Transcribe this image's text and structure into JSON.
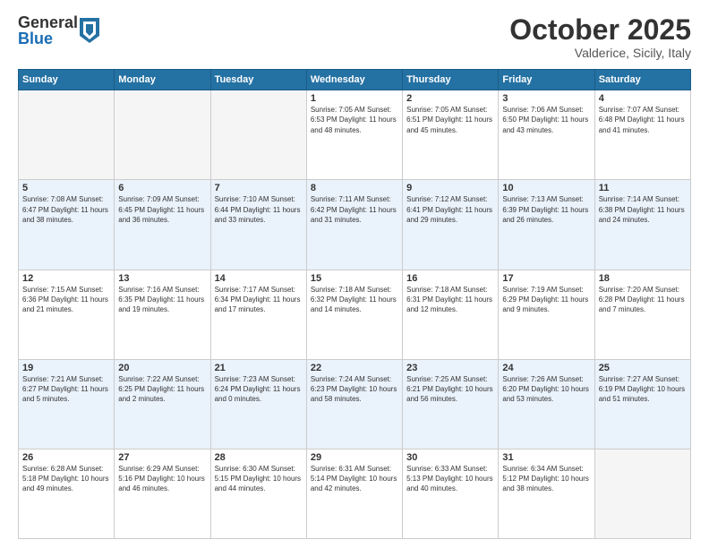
{
  "header": {
    "logo": {
      "general": "General",
      "blue": "Blue"
    },
    "title": "October 2025",
    "location": "Valderice, Sicily, Italy"
  },
  "days_of_week": [
    "Sunday",
    "Monday",
    "Tuesday",
    "Wednesday",
    "Thursday",
    "Friday",
    "Saturday"
  ],
  "weeks": [
    [
      {
        "day": "",
        "info": ""
      },
      {
        "day": "",
        "info": ""
      },
      {
        "day": "",
        "info": ""
      },
      {
        "day": "1",
        "info": "Sunrise: 7:05 AM\nSunset: 6:53 PM\nDaylight: 11 hours\nand 48 minutes."
      },
      {
        "day": "2",
        "info": "Sunrise: 7:05 AM\nSunset: 6:51 PM\nDaylight: 11 hours\nand 45 minutes."
      },
      {
        "day": "3",
        "info": "Sunrise: 7:06 AM\nSunset: 6:50 PM\nDaylight: 11 hours\nand 43 minutes."
      },
      {
        "day": "4",
        "info": "Sunrise: 7:07 AM\nSunset: 6:48 PM\nDaylight: 11 hours\nand 41 minutes."
      }
    ],
    [
      {
        "day": "5",
        "info": "Sunrise: 7:08 AM\nSunset: 6:47 PM\nDaylight: 11 hours\nand 38 minutes."
      },
      {
        "day": "6",
        "info": "Sunrise: 7:09 AM\nSunset: 6:45 PM\nDaylight: 11 hours\nand 36 minutes."
      },
      {
        "day": "7",
        "info": "Sunrise: 7:10 AM\nSunset: 6:44 PM\nDaylight: 11 hours\nand 33 minutes."
      },
      {
        "day": "8",
        "info": "Sunrise: 7:11 AM\nSunset: 6:42 PM\nDaylight: 11 hours\nand 31 minutes."
      },
      {
        "day": "9",
        "info": "Sunrise: 7:12 AM\nSunset: 6:41 PM\nDaylight: 11 hours\nand 29 minutes."
      },
      {
        "day": "10",
        "info": "Sunrise: 7:13 AM\nSunset: 6:39 PM\nDaylight: 11 hours\nand 26 minutes."
      },
      {
        "day": "11",
        "info": "Sunrise: 7:14 AM\nSunset: 6:38 PM\nDaylight: 11 hours\nand 24 minutes."
      }
    ],
    [
      {
        "day": "12",
        "info": "Sunrise: 7:15 AM\nSunset: 6:36 PM\nDaylight: 11 hours\nand 21 minutes."
      },
      {
        "day": "13",
        "info": "Sunrise: 7:16 AM\nSunset: 6:35 PM\nDaylight: 11 hours\nand 19 minutes."
      },
      {
        "day": "14",
        "info": "Sunrise: 7:17 AM\nSunset: 6:34 PM\nDaylight: 11 hours\nand 17 minutes."
      },
      {
        "day": "15",
        "info": "Sunrise: 7:18 AM\nSunset: 6:32 PM\nDaylight: 11 hours\nand 14 minutes."
      },
      {
        "day": "16",
        "info": "Sunrise: 7:18 AM\nSunset: 6:31 PM\nDaylight: 11 hours\nand 12 minutes."
      },
      {
        "day": "17",
        "info": "Sunrise: 7:19 AM\nSunset: 6:29 PM\nDaylight: 11 hours\nand 9 minutes."
      },
      {
        "day": "18",
        "info": "Sunrise: 7:20 AM\nSunset: 6:28 PM\nDaylight: 11 hours\nand 7 minutes."
      }
    ],
    [
      {
        "day": "19",
        "info": "Sunrise: 7:21 AM\nSunset: 6:27 PM\nDaylight: 11 hours\nand 5 minutes."
      },
      {
        "day": "20",
        "info": "Sunrise: 7:22 AM\nSunset: 6:25 PM\nDaylight: 11 hours\nand 2 minutes."
      },
      {
        "day": "21",
        "info": "Sunrise: 7:23 AM\nSunset: 6:24 PM\nDaylight: 11 hours\nand 0 minutes."
      },
      {
        "day": "22",
        "info": "Sunrise: 7:24 AM\nSunset: 6:23 PM\nDaylight: 10 hours\nand 58 minutes."
      },
      {
        "day": "23",
        "info": "Sunrise: 7:25 AM\nSunset: 6:21 PM\nDaylight: 10 hours\nand 56 minutes."
      },
      {
        "day": "24",
        "info": "Sunrise: 7:26 AM\nSunset: 6:20 PM\nDaylight: 10 hours\nand 53 minutes."
      },
      {
        "day": "25",
        "info": "Sunrise: 7:27 AM\nSunset: 6:19 PM\nDaylight: 10 hours\nand 51 minutes."
      }
    ],
    [
      {
        "day": "26",
        "info": "Sunrise: 6:28 AM\nSunset: 5:18 PM\nDaylight: 10 hours\nand 49 minutes."
      },
      {
        "day": "27",
        "info": "Sunrise: 6:29 AM\nSunset: 5:16 PM\nDaylight: 10 hours\nand 46 minutes."
      },
      {
        "day": "28",
        "info": "Sunrise: 6:30 AM\nSunset: 5:15 PM\nDaylight: 10 hours\nand 44 minutes."
      },
      {
        "day": "29",
        "info": "Sunrise: 6:31 AM\nSunset: 5:14 PM\nDaylight: 10 hours\nand 42 minutes."
      },
      {
        "day": "30",
        "info": "Sunrise: 6:33 AM\nSunset: 5:13 PM\nDaylight: 10 hours\nand 40 minutes."
      },
      {
        "day": "31",
        "info": "Sunrise: 6:34 AM\nSunset: 5:12 PM\nDaylight: 10 hours\nand 38 minutes."
      },
      {
        "day": "",
        "info": ""
      }
    ]
  ]
}
